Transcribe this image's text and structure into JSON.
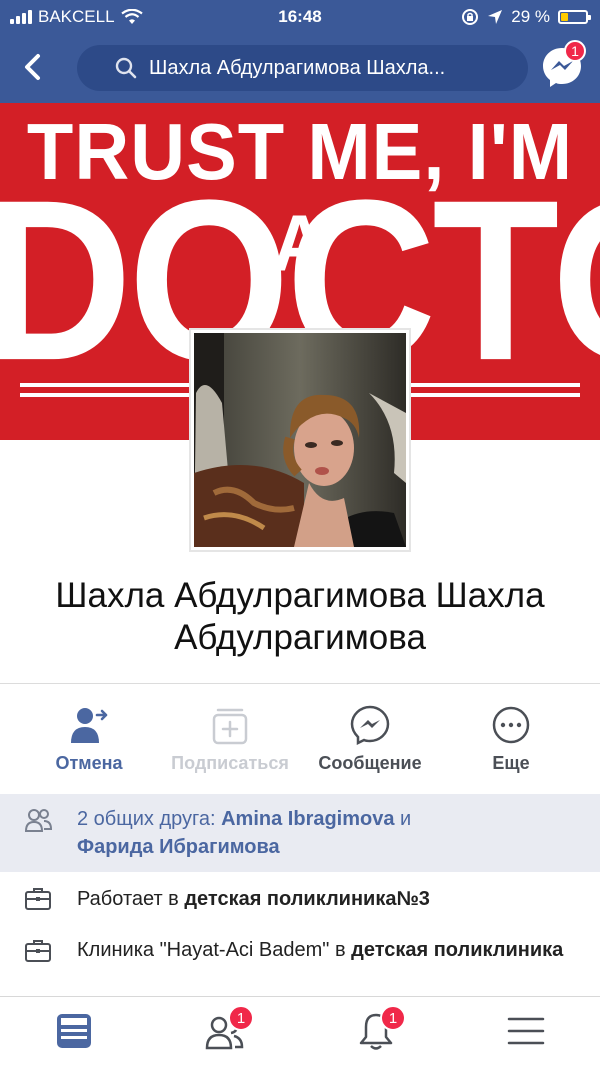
{
  "status_bar": {
    "carrier": "BAKCELL",
    "time": "16:48",
    "battery": "29 %",
    "battery_level": 0.29
  },
  "nav": {
    "search_text": "Шахла Абдулрагимова Шахла...",
    "messenger_badge": "1"
  },
  "cover": {
    "line1": "TRUST ME, I'M A",
    "line2": "DOCTOR"
  },
  "profile": {
    "name": "Шахла Абдулрагимова Шахла Абдулрагимова"
  },
  "actions": [
    {
      "label": "Отмена",
      "icon": "friend-request-sent-icon",
      "color": "#4b67a1"
    },
    {
      "label": "Подписаться",
      "icon": "subscribe-icon",
      "color": "#c9ccd2"
    },
    {
      "label": "Сообщение",
      "icon": "messenger-icon",
      "color": "#4b4f56"
    },
    {
      "label": "Еще",
      "icon": "more-icon",
      "color": "#4b4f56"
    }
  ],
  "info": {
    "mutual_prefix": "2 общих друга: ",
    "mutual_friend_1": "Amina Ibragimova",
    "mutual_and": " и",
    "mutual_friend_2": "Фарида Ибрагимова",
    "work_prefix": "Работает в ",
    "work_place": "детская поликлиника№3",
    "clinic_prefix": "Клиника \"Hayat-Aci Badem\" в ",
    "clinic_place": "детская поликлиника"
  },
  "tabbar": {
    "friends_badge": "1",
    "notifications_badge": "1"
  }
}
